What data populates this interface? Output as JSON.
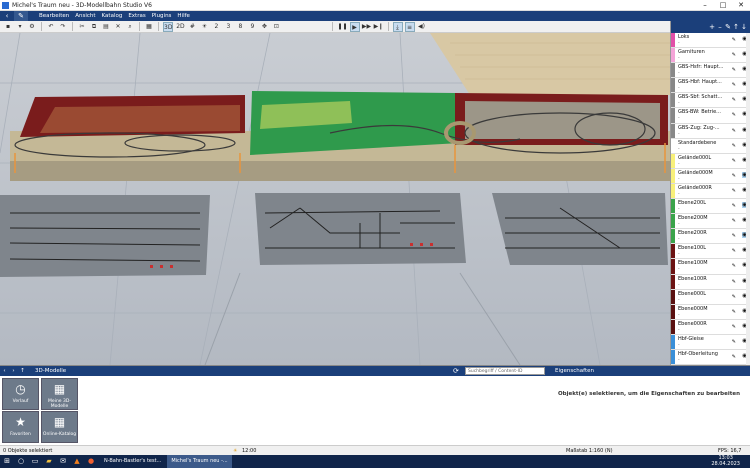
{
  "window": {
    "title": "Michel's Traum neu - 3D-Modellbahn Studio V6",
    "minimize": "–",
    "maximize": "□",
    "close": "✕"
  },
  "menu": {
    "items": [
      "Bearbeiten",
      "Ansicht",
      "Katalog",
      "Extras",
      "Plugins",
      "Hilfe"
    ]
  },
  "toolbar": {
    "view3d": "3D",
    "view2d": "2D",
    "num2": "2",
    "num3": "3",
    "num8": "8",
    "num9": "9"
  },
  "layers": [
    {
      "name": "Loks",
      "color": "#e24fa8"
    },
    {
      "name": "Garnituren",
      "color": "#f4a4d8"
    },
    {
      "name": "GBS-Hsfr: Haupt...",
      "color": "#888888"
    },
    {
      "name": "GBS-Hbf: Haupt...",
      "color": "#888888"
    },
    {
      "name": "GBS-Sbf: Schatt...",
      "color": "#888888"
    },
    {
      "name": "GBS-BW: Betrie...",
      "color": "#888888"
    },
    {
      "name": "GBS-Zug: Zug-...",
      "color": "#888888"
    },
    {
      "name": "Standardebene",
      "color": "#ffffff"
    },
    {
      "name": "Gelände000L",
      "color": "#f8f07a"
    },
    {
      "name": "Gelände000M",
      "color": "#f8f07a"
    },
    {
      "name": "Gelände000R",
      "color": "#f8f07a"
    },
    {
      "name": "Ebene200L",
      "color": "#3aa34a"
    },
    {
      "name": "Ebene200M",
      "color": "#3aa34a"
    },
    {
      "name": "Ebene200R",
      "color": "#3aa34a"
    },
    {
      "name": "Ebene100L",
      "color": "#6b1212"
    },
    {
      "name": "Ebene100M",
      "color": "#6b1212"
    },
    {
      "name": "Ebene100R",
      "color": "#6b1212"
    },
    {
      "name": "Ebene000L",
      "color": "#5a1010"
    },
    {
      "name": "Ebene000M",
      "color": "#5a1010"
    },
    {
      "name": "Ebene000R",
      "color": "#5a1010"
    },
    {
      "name": "Hbf-Gleise",
      "color": "#3a8fd8"
    },
    {
      "name": "Hbf-Oberleitung",
      "color": "#3a8fd8"
    }
  ],
  "bottom": {
    "models_title": "3D-Modelle",
    "search_placeholder": "Suchbegriff / Content-ID",
    "tiles": [
      {
        "label": "Verlauf",
        "icon": "◷"
      },
      {
        "label": "Meine 3D-Modelle",
        "icon": "▦"
      },
      {
        "label": "Favoriten",
        "icon": "★"
      },
      {
        "label": "Online-Katalog",
        "icon": "▦"
      }
    ],
    "props_title": "Eigenschaften",
    "props_msg": "Objekt(e) selektieren, um die Eigenschaften zu bearbeiten"
  },
  "status": {
    "selected": "0 Objekte selektiert",
    "time": "12:00",
    "scale": "Maßstab 1:160 (N)",
    "fps": "FPS: 16,7"
  },
  "taskbar": {
    "app1": "N-Bahn-Bastler's test...",
    "app2": "Michel's Traum neu -...",
    "clock": "13:03",
    "date": "28.04.2023"
  }
}
